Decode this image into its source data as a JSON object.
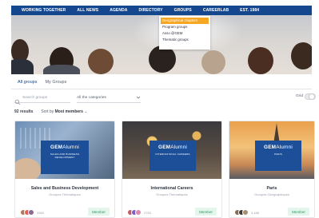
{
  "nav": {
    "items": [
      "WORKING TOGETHER",
      "ALL NEWS",
      "AGENDA",
      "DIRECTORY",
      "GROUPS",
      "CAREERLAB",
      "EST. 1984"
    ]
  },
  "groups_menu": {
    "items": [
      "Geographical chapters",
      "Program groups",
      "Asso @GEM",
      "Thematic groups"
    ],
    "active_index": 0
  },
  "tabs": [
    "All groups",
    "My Groups"
  ],
  "filters": {
    "search_placeholder": "Search groups",
    "category_value": "All the categories",
    "grid_label": "Grid"
  },
  "results": {
    "count_text": "92 results",
    "sort_label": "Sort by",
    "sort_value": "Most members"
  },
  "cards": [
    {
      "logo_main": "GEM",
      "logo_sub": "Alumni",
      "badge_text": "SALES AND BUSINESS DEVELOPMENT",
      "title": "Sales and Business Development",
      "type": "Groupes Thématiques",
      "members_count": "3350",
      "button": "Member"
    },
    {
      "logo_main": "GEM",
      "logo_sub": "Alumni",
      "badge_text": "INTERNATIONAL CAREERS",
      "title": "International Careers",
      "type": "Groupes Thématiques",
      "members_count": "2763",
      "button": "Member"
    },
    {
      "logo_main": "GEM",
      "logo_sub": "Alumni",
      "badge_text": "PARIS",
      "title": "Paris",
      "type": "Groupes Géographiques",
      "members_count": "3,188",
      "button": "Member"
    }
  ],
  "colors": {
    "nav_bg": "#14478d",
    "dropdown_active": "#f5a623",
    "badge_bg": "#1d4f98",
    "member_bg": "#e4f5ec",
    "member_text": "#2e9c63"
  }
}
